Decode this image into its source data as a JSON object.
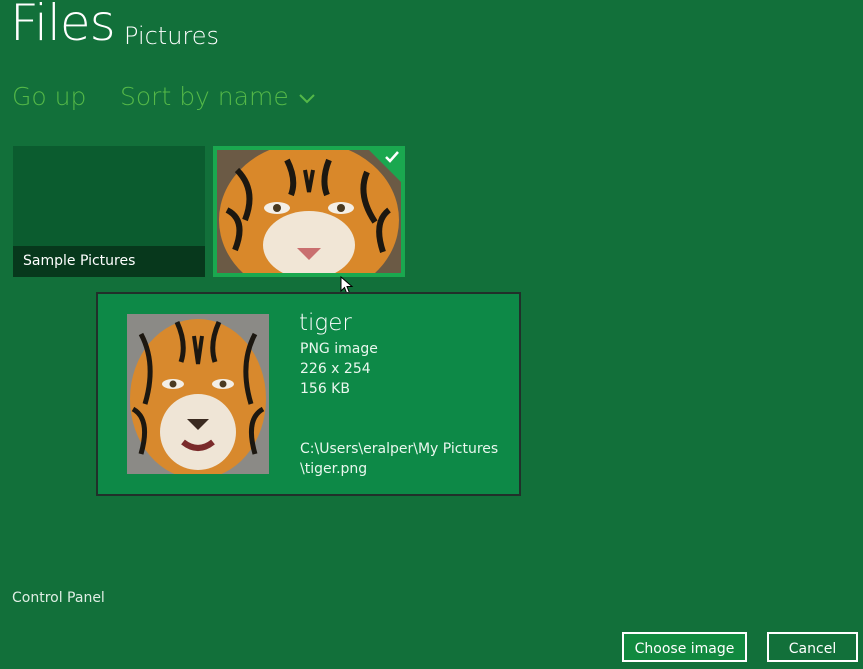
{
  "header": {
    "title": "Files",
    "location": "Pictures"
  },
  "commands": {
    "go_up": "Go up",
    "sort": "Sort by name"
  },
  "tiles": [
    {
      "label": "Sample Pictures",
      "type": "folder"
    },
    {
      "type": "image",
      "selected": true
    }
  ],
  "tooltip": {
    "name": "tiger",
    "type": "PNG image",
    "dimensions": "226 x 254",
    "size": "156 KB",
    "path_line1": "C:\\Users\\eralper\\My Pictures",
    "path_line2": "\\tiger.png"
  },
  "footer": {
    "control_panel": "Control Panel"
  },
  "buttons": {
    "choose": "Choose image",
    "cancel": "Cancel"
  },
  "colors": {
    "background": "#12703a",
    "accent_text": "#54b848",
    "selection": "#1aa84f",
    "tooltip_bg": "#0d8947"
  }
}
